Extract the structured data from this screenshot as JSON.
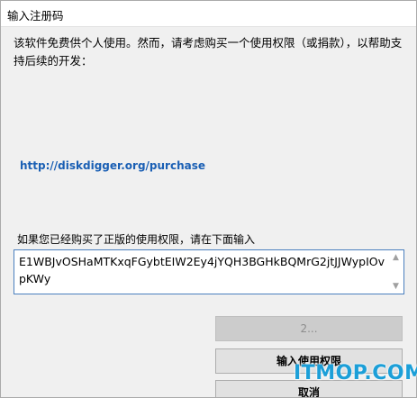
{
  "window": {
    "title": "输入注册码"
  },
  "description": "该软件免费供个人使用。然而，请考虑购买一个使用权限（或捐款），以帮助支持后续的开发：",
  "purchase_link": "http://diskdigger.org/purchase",
  "license_prompt": "如果您已经购买了正版的使用权限，请在下面输入",
  "license_input": {
    "value": "E1WBJvOSHaMTKxqFGybtEIW2Ey4jYQH3BGHkBQMrG2jtJJWypIOvpKWy"
  },
  "buttons": {
    "disabled_label": "2...",
    "enter_license_label": "输入使用权限",
    "cancel_label": "取消"
  },
  "watermark": "ITMOP.COM",
  "icons": {
    "scroll_up": "chevron-up-icon",
    "scroll_down": "chevron-down-icon"
  }
}
